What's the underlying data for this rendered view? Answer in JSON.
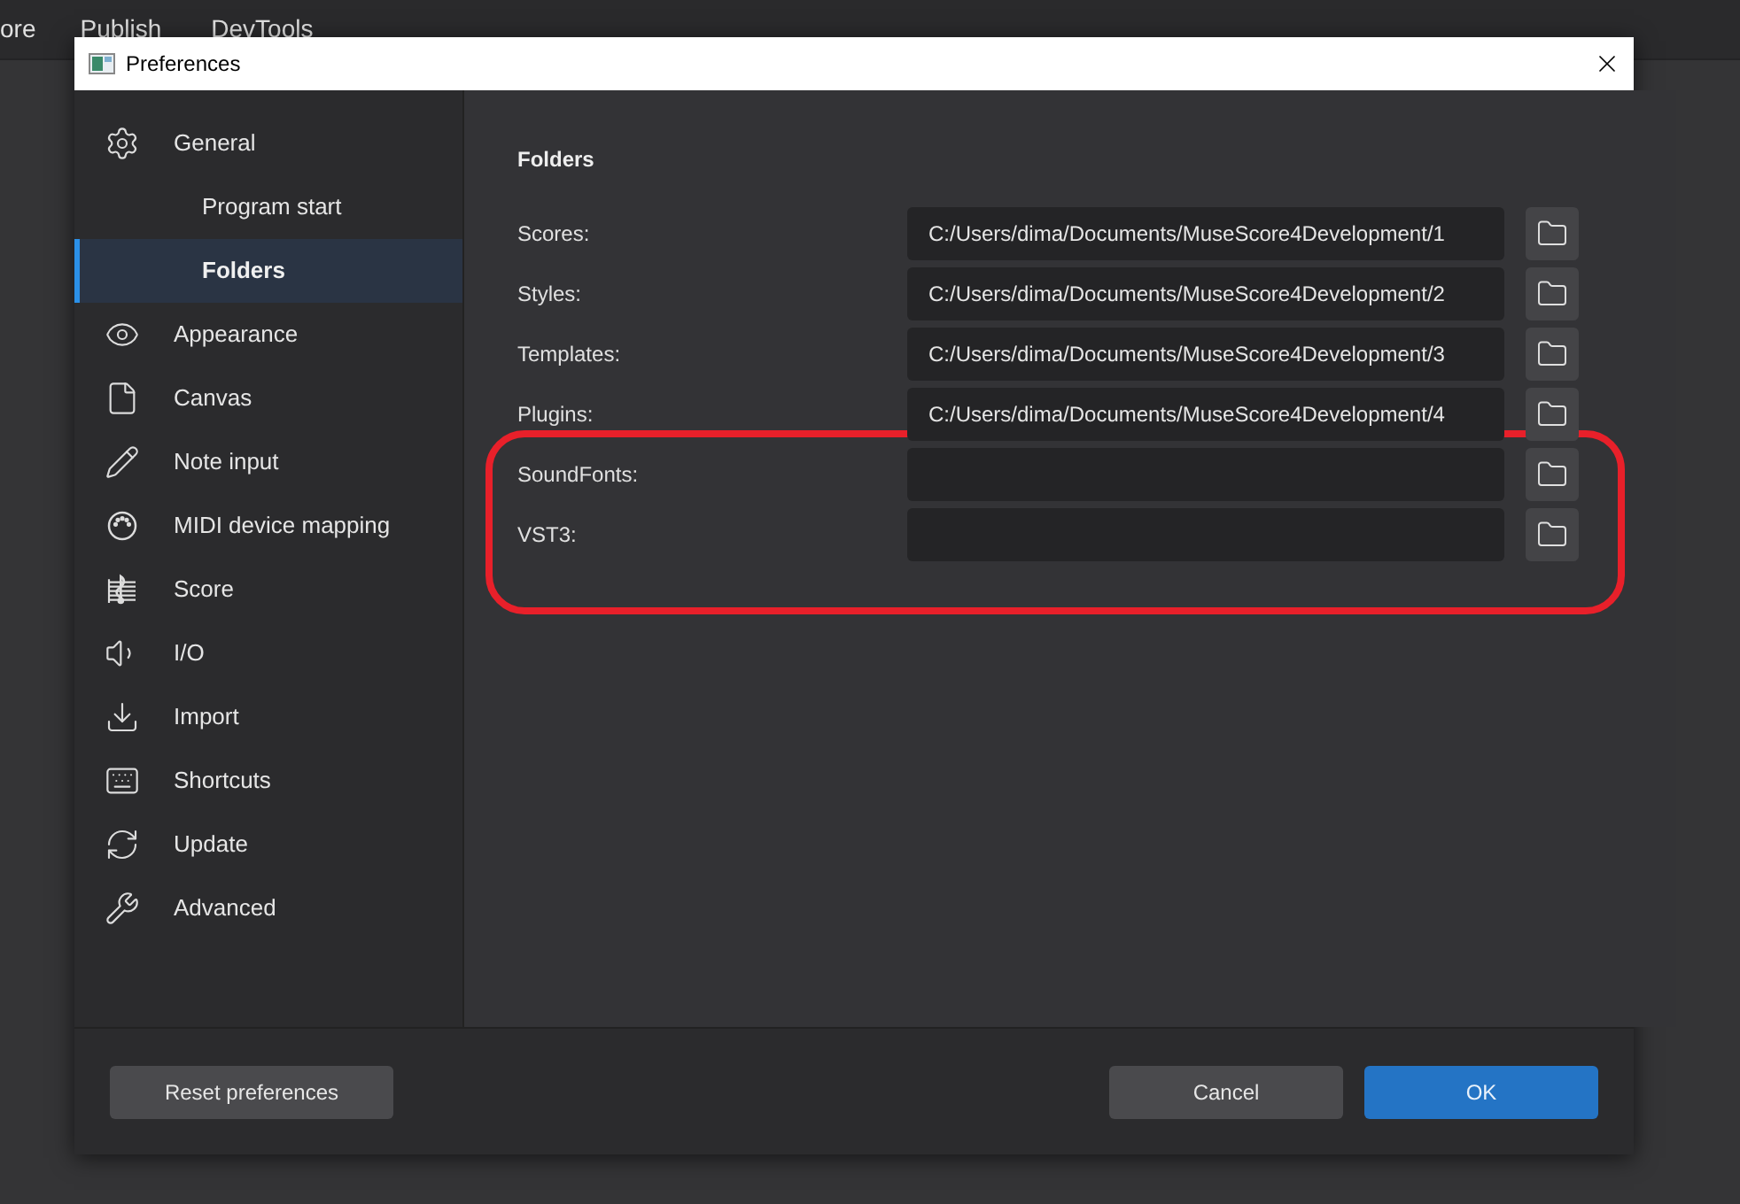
{
  "app_menu": [
    "ore",
    "Publish",
    "DevTools"
  ],
  "window": {
    "title": "Preferences"
  },
  "sidebar": {
    "items": [
      {
        "label": "General",
        "selected": false,
        "children": [
          {
            "label": "Program start",
            "selected": false
          },
          {
            "label": "Folders",
            "selected": true
          }
        ]
      },
      {
        "label": "Appearance",
        "selected": false
      },
      {
        "label": "Canvas",
        "selected": false
      },
      {
        "label": "Note input",
        "selected": false
      },
      {
        "label": "MIDI device mapping",
        "selected": false
      },
      {
        "label": "Score",
        "selected": false
      },
      {
        "label": "I/O",
        "selected": false
      },
      {
        "label": "Import",
        "selected": false
      },
      {
        "label": "Shortcuts",
        "selected": false
      },
      {
        "label": "Update",
        "selected": false
      },
      {
        "label": "Advanced",
        "selected": false
      }
    ]
  },
  "section": {
    "title": "Folders",
    "folders": [
      {
        "label": "Scores:",
        "value": "C:/Users/dima/Documents/MuseScore4Development/1"
      },
      {
        "label": "Styles:",
        "value": "C:/Users/dima/Documents/MuseScore4Development/2"
      },
      {
        "label": "Templates:",
        "value": "C:/Users/dima/Documents/MuseScore4Development/3"
      },
      {
        "label": "Plugins:",
        "value": "C:/Users/dima/Documents/MuseScore4Development/4"
      }
    ],
    "highlight_annotation": {
      "folders": [
        {
          "label": "SoundFonts:"
        },
        {
          "label": "VST3:"
        }
      ]
    }
  },
  "footer": {
    "reset_button": "Reset preferences",
    "cancel_button": "Cancel",
    "ok_button": "OK"
  }
}
